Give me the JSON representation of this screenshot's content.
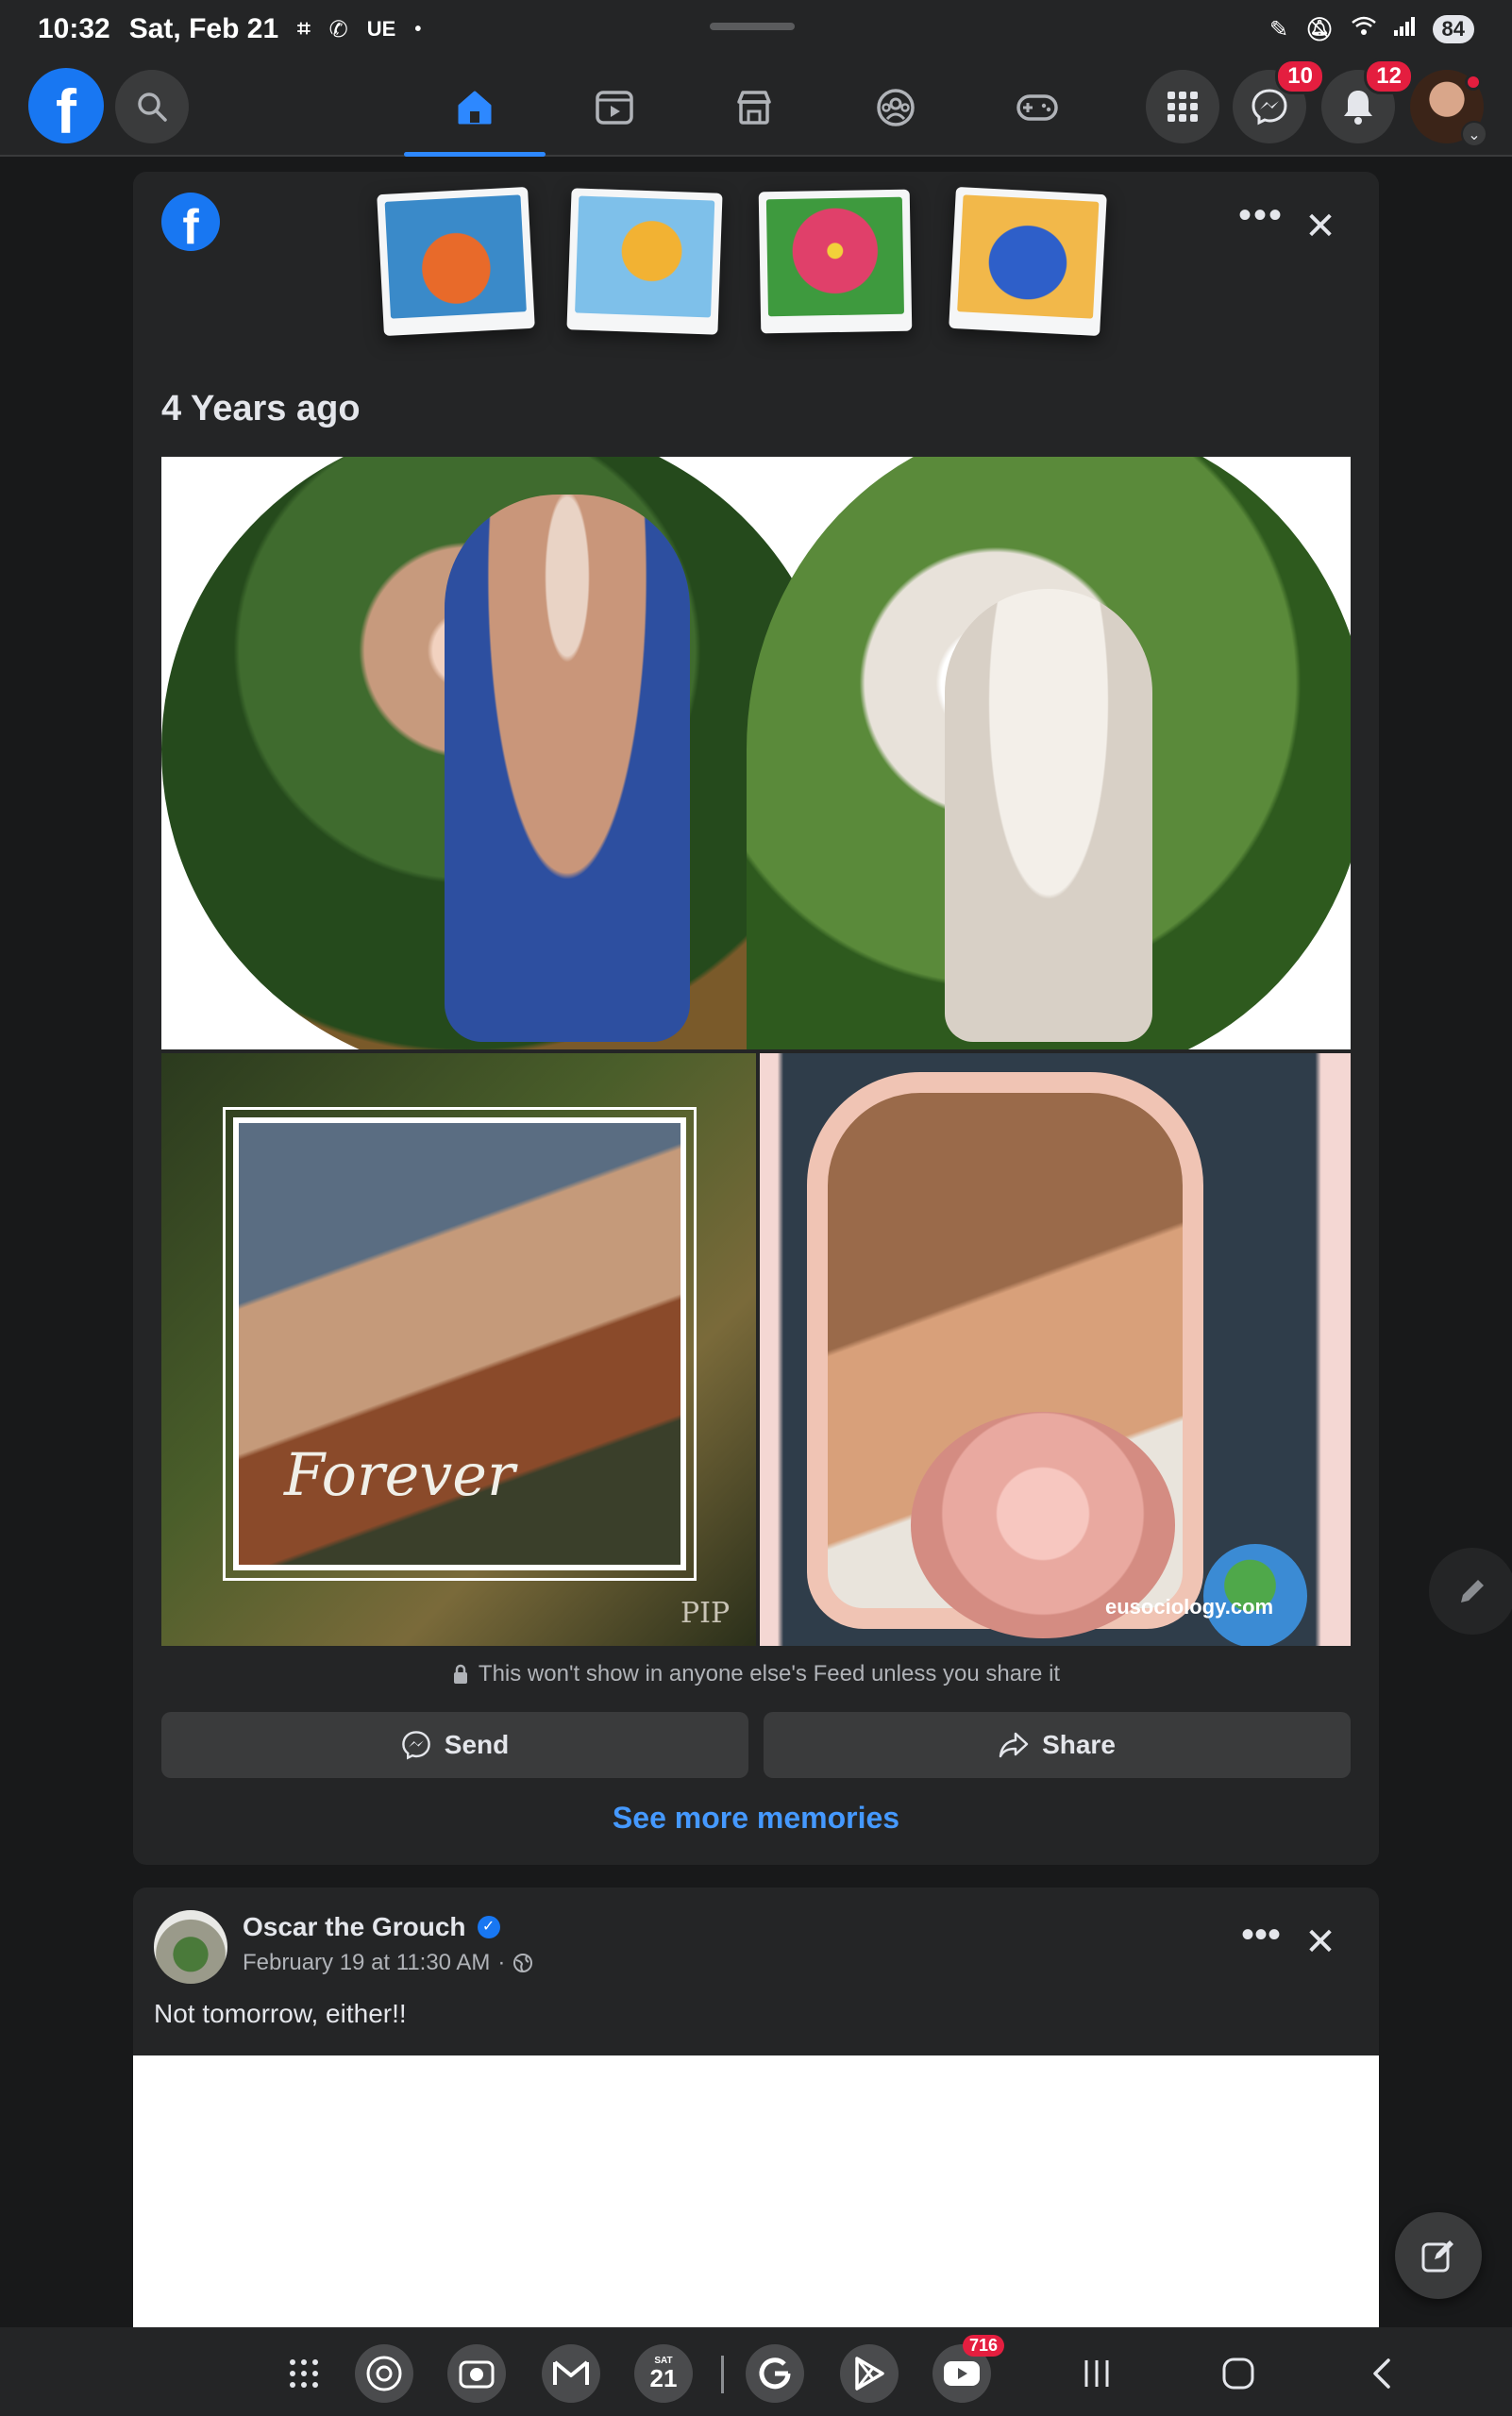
{
  "status_bar": {
    "time": "10:32",
    "date": "Sat, Feb 21",
    "carrier_label": "UE",
    "battery": "84"
  },
  "top_nav": {
    "logo_letter": "f",
    "tabs": [
      {
        "name": "home",
        "icon": "home-icon",
        "active": true
      },
      {
        "name": "video",
        "icon": "video-icon",
        "active": false
      },
      {
        "name": "marketplace",
        "icon": "marketplace-icon",
        "active": false
      },
      {
        "name": "groups",
        "icon": "groups-icon",
        "active": false
      },
      {
        "name": "gaming",
        "icon": "gaming-icon",
        "active": false
      }
    ],
    "messenger_badge": "10",
    "notifications_badge": "12"
  },
  "memories_card": {
    "logo_letter": "f",
    "title": "4 Years ago",
    "photo_text_forever": "Forever",
    "photo_text_pip": "PIP",
    "photo_watermark": "eusociology.com",
    "privacy_note": "This won't show in anyone else's Feed unless you share it",
    "send_label": "Send",
    "share_label": "Share",
    "see_more_label": "See more memories"
  },
  "post": {
    "author": "Oscar the Grouch",
    "timestamp": "February 19 at 11:30 AM",
    "separator": "·",
    "text": "Not tomorrow, either!!"
  },
  "taskbar": {
    "calendar_day": "21",
    "calendar_weekday": "SAT",
    "youtube_badge": "716"
  },
  "colors": {
    "facebook_blue": "#1877f2",
    "link_blue": "#4599ff",
    "badge_red": "#e41e3f",
    "card_bg": "#242526",
    "page_bg": "#18191a"
  }
}
